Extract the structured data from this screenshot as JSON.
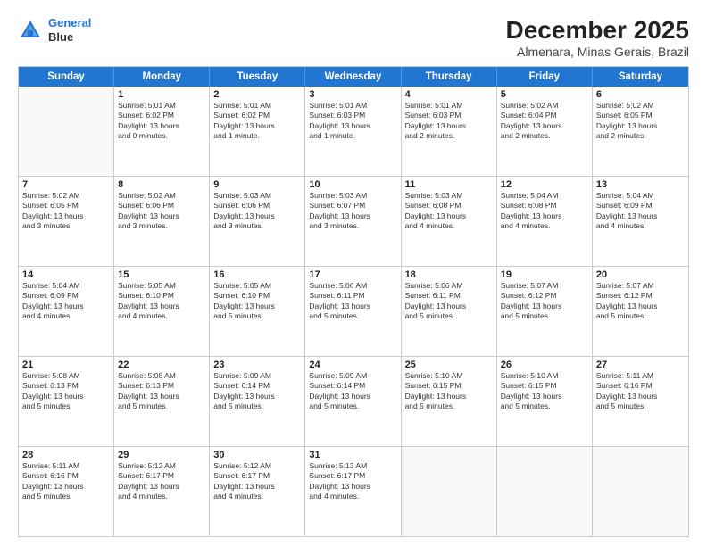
{
  "header": {
    "logo_line1": "General",
    "logo_line2": "Blue",
    "title": "December 2025",
    "subtitle": "Almenara, Minas Gerais, Brazil"
  },
  "days_of_week": [
    "Sunday",
    "Monday",
    "Tuesday",
    "Wednesday",
    "Thursday",
    "Friday",
    "Saturday"
  ],
  "rows": [
    [
      {
        "day": "",
        "info": ""
      },
      {
        "day": "1",
        "info": "Sunrise: 5:01 AM\nSunset: 6:02 PM\nDaylight: 13 hours\nand 0 minutes."
      },
      {
        "day": "2",
        "info": "Sunrise: 5:01 AM\nSunset: 6:02 PM\nDaylight: 13 hours\nand 1 minute."
      },
      {
        "day": "3",
        "info": "Sunrise: 5:01 AM\nSunset: 6:03 PM\nDaylight: 13 hours\nand 1 minute."
      },
      {
        "day": "4",
        "info": "Sunrise: 5:01 AM\nSunset: 6:03 PM\nDaylight: 13 hours\nand 2 minutes."
      },
      {
        "day": "5",
        "info": "Sunrise: 5:02 AM\nSunset: 6:04 PM\nDaylight: 13 hours\nand 2 minutes."
      },
      {
        "day": "6",
        "info": "Sunrise: 5:02 AM\nSunset: 6:05 PM\nDaylight: 13 hours\nand 2 minutes."
      }
    ],
    [
      {
        "day": "7",
        "info": "Sunrise: 5:02 AM\nSunset: 6:05 PM\nDaylight: 13 hours\nand 3 minutes."
      },
      {
        "day": "8",
        "info": "Sunrise: 5:02 AM\nSunset: 6:06 PM\nDaylight: 13 hours\nand 3 minutes."
      },
      {
        "day": "9",
        "info": "Sunrise: 5:03 AM\nSunset: 6:06 PM\nDaylight: 13 hours\nand 3 minutes."
      },
      {
        "day": "10",
        "info": "Sunrise: 5:03 AM\nSunset: 6:07 PM\nDaylight: 13 hours\nand 3 minutes."
      },
      {
        "day": "11",
        "info": "Sunrise: 5:03 AM\nSunset: 6:08 PM\nDaylight: 13 hours\nand 4 minutes."
      },
      {
        "day": "12",
        "info": "Sunrise: 5:04 AM\nSunset: 6:08 PM\nDaylight: 13 hours\nand 4 minutes."
      },
      {
        "day": "13",
        "info": "Sunrise: 5:04 AM\nSunset: 6:09 PM\nDaylight: 13 hours\nand 4 minutes."
      }
    ],
    [
      {
        "day": "14",
        "info": "Sunrise: 5:04 AM\nSunset: 6:09 PM\nDaylight: 13 hours\nand 4 minutes."
      },
      {
        "day": "15",
        "info": "Sunrise: 5:05 AM\nSunset: 6:10 PM\nDaylight: 13 hours\nand 4 minutes."
      },
      {
        "day": "16",
        "info": "Sunrise: 5:05 AM\nSunset: 6:10 PM\nDaylight: 13 hours\nand 5 minutes."
      },
      {
        "day": "17",
        "info": "Sunrise: 5:06 AM\nSunset: 6:11 PM\nDaylight: 13 hours\nand 5 minutes."
      },
      {
        "day": "18",
        "info": "Sunrise: 5:06 AM\nSunset: 6:11 PM\nDaylight: 13 hours\nand 5 minutes."
      },
      {
        "day": "19",
        "info": "Sunrise: 5:07 AM\nSunset: 6:12 PM\nDaylight: 13 hours\nand 5 minutes."
      },
      {
        "day": "20",
        "info": "Sunrise: 5:07 AM\nSunset: 6:12 PM\nDaylight: 13 hours\nand 5 minutes."
      }
    ],
    [
      {
        "day": "21",
        "info": "Sunrise: 5:08 AM\nSunset: 6:13 PM\nDaylight: 13 hours\nand 5 minutes."
      },
      {
        "day": "22",
        "info": "Sunrise: 5:08 AM\nSunset: 6:13 PM\nDaylight: 13 hours\nand 5 minutes."
      },
      {
        "day": "23",
        "info": "Sunrise: 5:09 AM\nSunset: 6:14 PM\nDaylight: 13 hours\nand 5 minutes."
      },
      {
        "day": "24",
        "info": "Sunrise: 5:09 AM\nSunset: 6:14 PM\nDaylight: 13 hours\nand 5 minutes."
      },
      {
        "day": "25",
        "info": "Sunrise: 5:10 AM\nSunset: 6:15 PM\nDaylight: 13 hours\nand 5 minutes."
      },
      {
        "day": "26",
        "info": "Sunrise: 5:10 AM\nSunset: 6:15 PM\nDaylight: 13 hours\nand 5 minutes."
      },
      {
        "day": "27",
        "info": "Sunrise: 5:11 AM\nSunset: 6:16 PM\nDaylight: 13 hours\nand 5 minutes."
      }
    ],
    [
      {
        "day": "28",
        "info": "Sunrise: 5:11 AM\nSunset: 6:16 PM\nDaylight: 13 hours\nand 5 minutes."
      },
      {
        "day": "29",
        "info": "Sunrise: 5:12 AM\nSunset: 6:17 PM\nDaylight: 13 hours\nand 4 minutes."
      },
      {
        "day": "30",
        "info": "Sunrise: 5:12 AM\nSunset: 6:17 PM\nDaylight: 13 hours\nand 4 minutes."
      },
      {
        "day": "31",
        "info": "Sunrise: 5:13 AM\nSunset: 6:17 PM\nDaylight: 13 hours\nand 4 minutes."
      },
      {
        "day": "",
        "info": ""
      },
      {
        "day": "",
        "info": ""
      },
      {
        "day": "",
        "info": ""
      }
    ]
  ]
}
